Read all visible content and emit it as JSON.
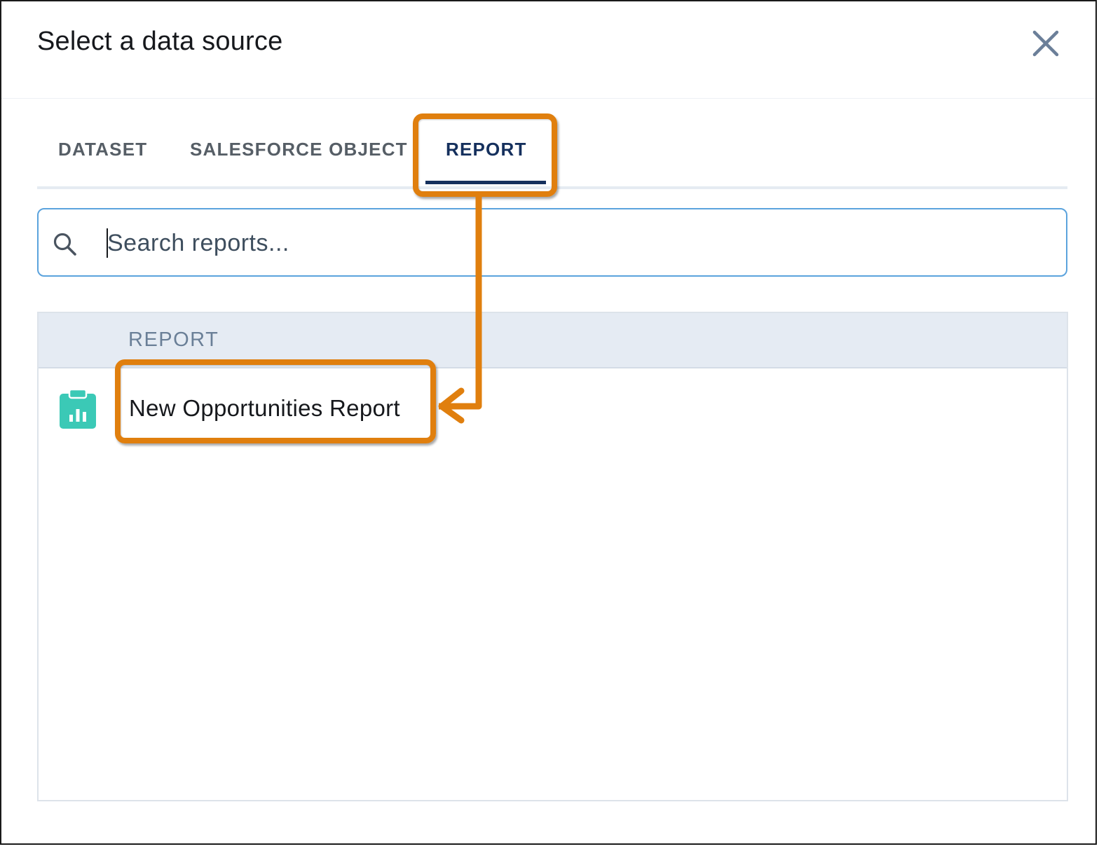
{
  "dialog": {
    "title": "Select a data source",
    "close_icon": "close-icon"
  },
  "tabs": [
    {
      "label": "DATASET",
      "active": false
    },
    {
      "label": "SALESFORCE OBJECT",
      "active": false
    },
    {
      "label": "REPORT",
      "active": true
    }
  ],
  "search": {
    "placeholder": "Search reports...",
    "value": "",
    "icon": "search-icon"
  },
  "table": {
    "column_header": "REPORT",
    "rows": [
      {
        "label": "New Opportunities Report",
        "icon": "report-icon"
      }
    ]
  },
  "colors": {
    "accent_tab": "#15305d",
    "search_border": "#5ba3dd",
    "report_icon": "#3bc9b6",
    "callout": "#e07f0e",
    "header_bg": "#e5ebf3"
  }
}
